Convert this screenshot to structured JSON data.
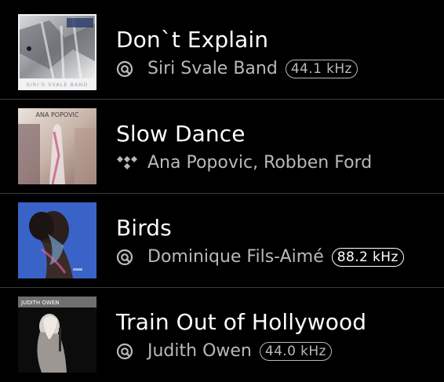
{
  "colors": {
    "background": "#000000",
    "title": "#ffffff",
    "subtitle": "#b9b9bc",
    "divider": "#3a3a3c",
    "badge_highlight": "#ffffff"
  },
  "tracks": [
    {
      "title": "Don`t Explain",
      "artist": "Siri Svale Band",
      "source_icon": "qobuz-icon",
      "quality": "44.1 kHz",
      "quality_highlight": false,
      "art_text": "SIRI'S SVALE BAND"
    },
    {
      "title": "Slow Dance",
      "artist": "Ana Popovic, Robben Ford",
      "source_icon": "tidal-icon",
      "quality": "",
      "quality_highlight": false,
      "art_text": "ANA POPOVIC"
    },
    {
      "title": "Birds",
      "artist": "Dominique Fils-Aimé",
      "source_icon": "qobuz-icon",
      "quality": "88.2 kHz",
      "quality_highlight": true,
      "art_text": ""
    },
    {
      "title": "Train Out of Hollywood",
      "artist": "Judith Owen",
      "source_icon": "qobuz-icon",
      "quality": "44.0 kHz",
      "quality_highlight": false,
      "art_text": "JUDITH OWEN"
    }
  ]
}
